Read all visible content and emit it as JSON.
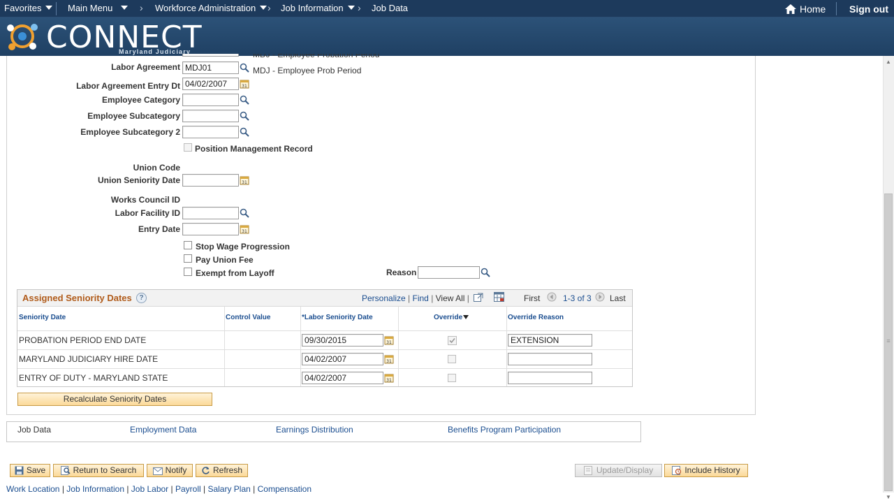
{
  "nav": {
    "favorites": "Favorites",
    "main_menu": "Main Menu",
    "breadcrumb_1": "Workforce Administration",
    "breadcrumb_2": "Job Information",
    "breadcrumb_3": "Job Data",
    "home": "Home",
    "sign_out": "Sign out"
  },
  "brand": {
    "name": "CONNECT",
    "sub": "Maryland Judiciary"
  },
  "form": {
    "prev_desc": "MDJ - Employee Probation Period",
    "labor_agreement_label": "Labor Agreement",
    "labor_agreement_value": "MDJ01",
    "labor_agreement_desc": "MDJ - Employee Prob Period",
    "labor_agreement_entry_label": "Labor Agreement Entry Dt",
    "labor_agreement_entry_value": "04/02/2007",
    "employee_category_label": "Employee Category",
    "employee_subcategory_label": "Employee Subcategory",
    "employee_subcategory2_label": "Employee Subcategory 2",
    "position_mgmt_label": "Position Management Record",
    "union_code_label": "Union Code",
    "union_seniority_label": "Union Seniority Date",
    "works_council_label": "Works Council ID",
    "labor_facility_label": "Labor Facility ID",
    "entry_date_label": "Entry Date",
    "stop_wage_label": "Stop Wage Progression",
    "pay_union_fee_label": "Pay Union Fee",
    "exempt_layoff_label": "Exempt from Layoff",
    "reason_label": "Reason"
  },
  "grid": {
    "title": "Assigned Seniority Dates",
    "personalize": "Personalize",
    "find": "Find",
    "view_all": "View All",
    "first": "First",
    "range": "1-3 of 3",
    "last": "Last",
    "columns": [
      "Seniority Date",
      "Control Value",
      "*Labor Seniority Date",
      "Override",
      "Override Reason"
    ],
    "rows": [
      {
        "seniority_date": "PROBATION PERIOD END DATE",
        "labor_date": "09/30/2015",
        "override": true,
        "reason": "EXTENSION"
      },
      {
        "seniority_date": "MARYLAND JUDICIARY HIRE DATE",
        "labor_date": "04/02/2007",
        "override": false,
        "reason": ""
      },
      {
        "seniority_date": "ENTRY OF DUTY - MARYLAND STATE",
        "labor_date": "04/02/2007",
        "override": false,
        "reason": ""
      }
    ],
    "recalc_button": "Recalculate Seniority Dates"
  },
  "tabs": [
    "Job Data",
    "Employment Data",
    "Earnings Distribution",
    "Benefits Program Participation"
  ],
  "toolbar": {
    "save": "Save",
    "return_to_search": "Return to Search",
    "notify": "Notify",
    "refresh": "Refresh",
    "update_display": "Update/Display",
    "include_history": "Include History"
  },
  "bottom_links": [
    "Work Location",
    "Job Information",
    "Job Labor",
    "Payroll",
    "Salary Plan",
    "Compensation"
  ],
  "colors": {
    "nav_bg": "#1d3a5c",
    "link": "#1a4d8f",
    "grid_title": "#b05b1a",
    "button_bg": "#fbd998"
  }
}
